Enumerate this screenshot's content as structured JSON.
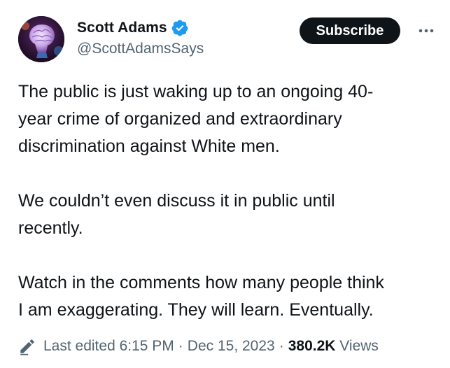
{
  "user": {
    "display_name": "Scott Adams",
    "handle": "@ScottAdamsSays",
    "verified": true,
    "verified_icon": "verified-badge-icon",
    "verified_color": "#1d9bf0"
  },
  "actions": {
    "subscribe_label": "Subscribe",
    "more_icon": "more-horizontal-icon"
  },
  "tweet": {
    "paragraphs": [
      "The public is just waking up to an ongoing 40-\nyear crime of organized and extraordinary\ndiscrimination against White men.",
      "We couldn’t even discuss it in public until\nrecently.",
      "Watch in the comments how many people think\nI am exaggerating. They will learn. Eventually."
    ]
  },
  "meta": {
    "edit_icon": "pencil-icon",
    "last_edited_label": "Last edited 6:15 PM",
    "separator": "·",
    "date": "Dec 15, 2023",
    "views_count": "380.2K",
    "views_label": "Views"
  },
  "colors": {
    "text_primary": "#0f1419",
    "text_secondary": "#536471",
    "button_bg": "#0f1419",
    "button_text": "#ffffff"
  }
}
